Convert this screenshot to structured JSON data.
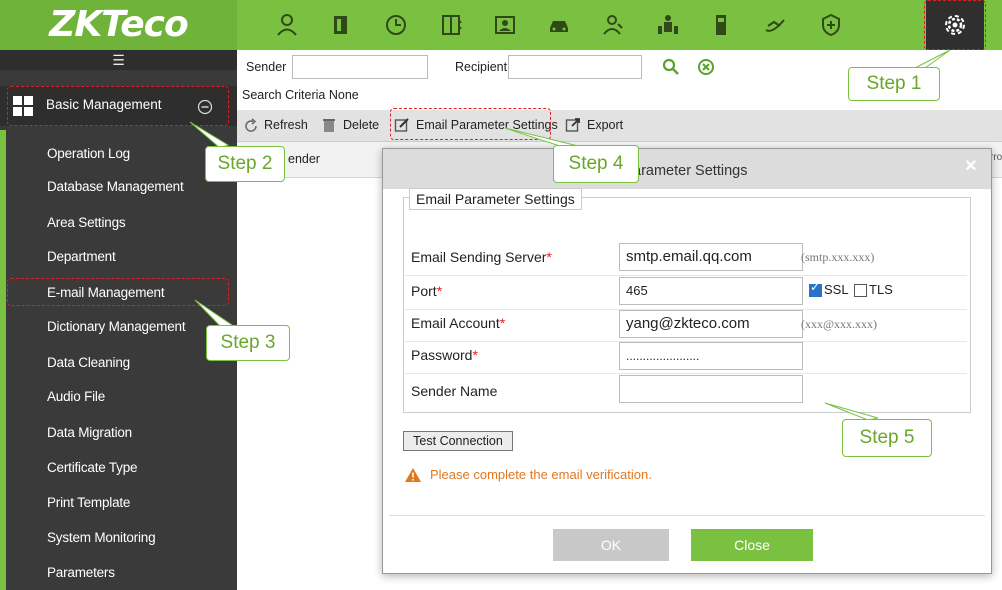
{
  "app": {
    "logo": "ZKTeco"
  },
  "topnav": {
    "icons": [
      "person-icon",
      "door-icon",
      "clock-icon",
      "elevator-icon",
      "visitor-icon",
      "parking-icon",
      "patrol-icon",
      "meeting-icon",
      "locker-icon",
      "consumption-icon",
      "security-icon",
      "gear-icon"
    ]
  },
  "sidebar": {
    "collapse_icon": "collapse-menu-icon",
    "group_label": "Basic Management",
    "items": [
      "Operation Log",
      "Database Management",
      "Area Settings",
      "Department",
      "E-mail Management",
      "Dictionary Management",
      "Data Cleaning",
      "Audio File",
      "Data Migration",
      "Certificate Type",
      "Print Template",
      "System Monitoring",
      "Parameters"
    ]
  },
  "search": {
    "sender_label": "Sender",
    "sender_value": "",
    "recipient_label": "Recipient",
    "recipient_value": "",
    "criteria": "Search Criteria None"
  },
  "toolbar": {
    "refresh": "Refresh",
    "delete": "Delete",
    "email_params": "Email Parameter Settings",
    "export": "Export"
  },
  "table": {
    "col_sender": "ender",
    "col_error": "rro"
  },
  "dialog": {
    "title": "arameter Settings",
    "close_glyph": "×",
    "legend": "Email Parameter Settings",
    "fields": {
      "server_label": "Email Sending Server",
      "server_value": "smtp.email.qq.com",
      "server_hint": "(smtp.xxx.xxx)",
      "port_label": "Port",
      "port_value": "465",
      "ssl_label": "SSL",
      "tls_label": "TLS",
      "account_label": "Email Account",
      "account_value": "yang@zkteco.com",
      "account_hint": "(xxx@xxx.xxx)",
      "password_label": "Password",
      "password_value": "......................",
      "sender_name_label": "Sender Name",
      "sender_name_value": "",
      "required_mark": "*"
    },
    "test_connection": "Test Connection",
    "warning": "Please complete the email verification.",
    "ok": "OK",
    "close": "Close"
  },
  "callouts": {
    "step1": "Step 1",
    "step2": "Step 2",
    "step3": "Step 3",
    "step4": "Step 4",
    "step5": "Step 5"
  },
  "colors": {
    "brand_green": "#7ac142",
    "sidebar_bg": "#3a3a3a",
    "highlight_red": "#e02020",
    "warning_orange": "#e07820"
  }
}
